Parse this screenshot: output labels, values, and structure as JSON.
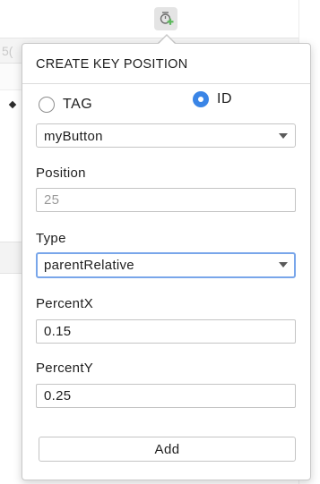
{
  "background": {
    "ruler_text": "5("
  },
  "popup": {
    "title": "CREATE KEY POSITION",
    "target_mode": {
      "options": [
        "TAG",
        "ID"
      ],
      "selected": "ID"
    },
    "target_id": "myButton",
    "position": {
      "label": "Position",
      "placeholder": "25"
    },
    "type": {
      "label": "Type",
      "value": "parentRelative"
    },
    "percent_x": {
      "label": "PercentX",
      "value": "0.15"
    },
    "percent_y": {
      "label": "PercentY",
      "value": "0.25"
    },
    "add_label": "Add"
  },
  "colors": {
    "accent": "#3a85e6",
    "focus_border": "#79a6ea",
    "add_icon_green": "#5cb85c"
  },
  "icons": {
    "toolbar": "create-key-position-icon"
  }
}
